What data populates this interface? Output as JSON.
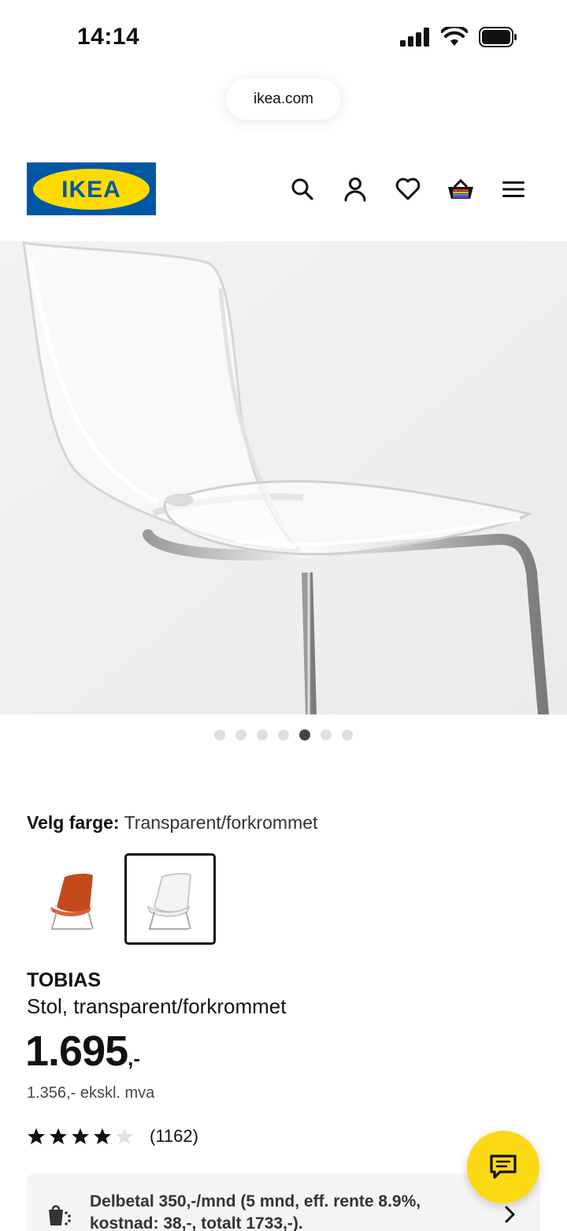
{
  "status_bar": {
    "time": "14:14"
  },
  "browser": {
    "url": "ikea.com"
  },
  "header": {
    "logo_text": "IKEA",
    "brand_colors": {
      "blue": "#0058a3",
      "yellow": "#ffdb00"
    },
    "icons": [
      "search-icon",
      "account-icon",
      "heart-icon",
      "basket-icon",
      "menu-icon"
    ]
  },
  "gallery": {
    "total_images": 7,
    "active_index": 4
  },
  "color_picker": {
    "label": "Velg farge:",
    "selected_value": "Transparent/forkrommet",
    "options": [
      {
        "name": "orange",
        "color": "#c44a1c",
        "selected": false
      },
      {
        "name": "transparent",
        "color": "#e8e8e8",
        "selected": true
      }
    ]
  },
  "product": {
    "name": "TOBIAS",
    "description": "Stol, transparent/forkrommet",
    "price": "1.695",
    "price_suffix": ",-",
    "price_ex_vat": "1.356,- ekskl. mva",
    "rating": 4,
    "rating_max": 5,
    "review_count": "(1162)"
  },
  "finance": {
    "text": "Delbetal 350,-/mnd (5 mnd, eff. rente 8.9%, kostnad: 38,-, totalt 1733,-)."
  },
  "chat": {
    "icon": "chat-icon",
    "color": "#fbd914"
  }
}
